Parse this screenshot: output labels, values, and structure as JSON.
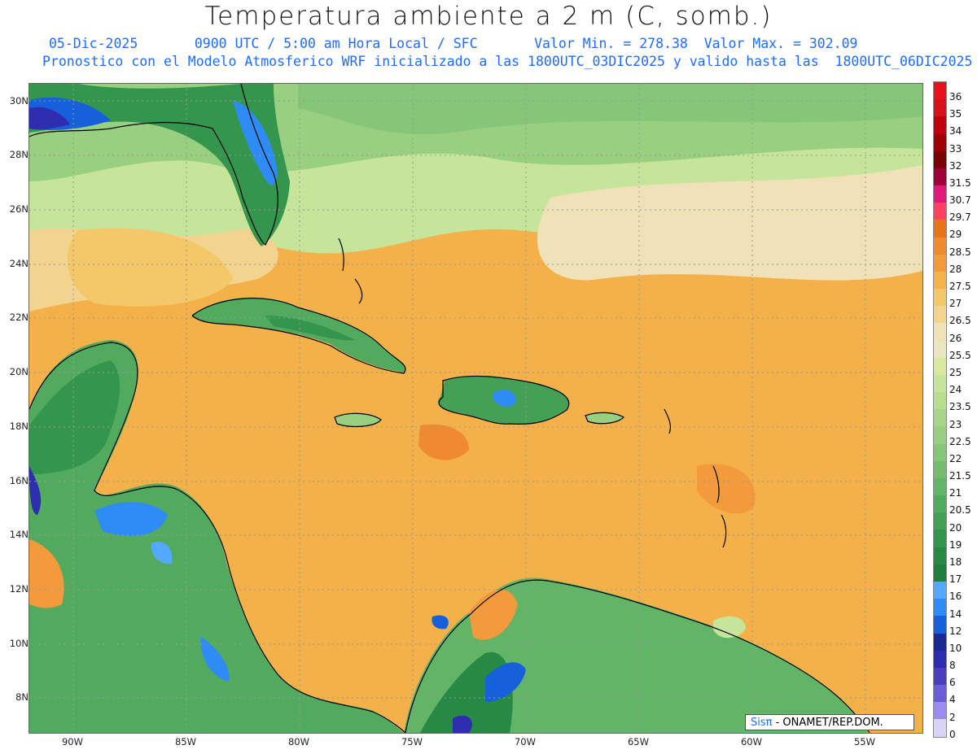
{
  "title": "Temperatura ambiente a 2 m (C, somb.)",
  "subtitle_line1": {
    "date": "05-Dic-2025",
    "time": "0900 UTC / 5:00 am Hora Local / SFC",
    "min": "Valor Min. = 278.38",
    "max": "Valor Max. = 302.09"
  },
  "subtitle_line2": "Pronostico con el Modelo Atmosferico WRF inicializado a las 1800UTC_03DIC2025 y valido hasta las  1800UTC_06DIC2025",
  "lat_labels": [
    "30N",
    "28N",
    "26N",
    "24N",
    "22N",
    "20N",
    "18N",
    "16N",
    "14N",
    "12N",
    "10N",
    "8N"
  ],
  "lon_labels": [
    "90W",
    "85W",
    "80W",
    "75W",
    "70W",
    "65W",
    "60W",
    "55W"
  ],
  "colorbar": {
    "labels": [
      "36",
      "35",
      "34",
      "33",
      "32",
      "31.5",
      "30.7",
      "29.7",
      "29",
      "28.5",
      "28",
      "27.5",
      "27",
      "26.5",
      "26",
      "25.5",
      "25",
      "24",
      "23.5",
      "23",
      "22.5",
      "22",
      "21.5",
      "21",
      "20.5",
      "20",
      "19",
      "18",
      "17",
      "16",
      "14",
      "12",
      "10",
      "8",
      "6",
      "4",
      "2",
      "0"
    ],
    "colors": [
      "#e8101a",
      "#d8101a",
      "#c0000c",
      "#a00008",
      "#7a0005",
      "#a0003a",
      "#e0187a",
      "#ff4060",
      "#e87418",
      "#f08a30",
      "#f29a3c",
      "#f4b24a",
      "#f4c868",
      "#f2d490",
      "#efe2b8",
      "#eae6c0",
      "#d8e8a0",
      "#c6e49a",
      "#b8de90",
      "#a8d688",
      "#98cf80",
      "#86c678",
      "#74bd6e",
      "#62b466",
      "#52aa5e",
      "#43a055",
      "#34954c",
      "#278a44",
      "#1f7e3c",
      "#55a8ff",
      "#2f8cf6",
      "#1660dc",
      "#1a2a90",
      "#2e2db0",
      "#4a3ec0",
      "#6b5cd8",
      "#9d8cf0",
      "#d8d4f8"
    ]
  },
  "credit": {
    "brand": "Sisπ",
    "text": " - ONAMET/REP.DOM."
  }
}
